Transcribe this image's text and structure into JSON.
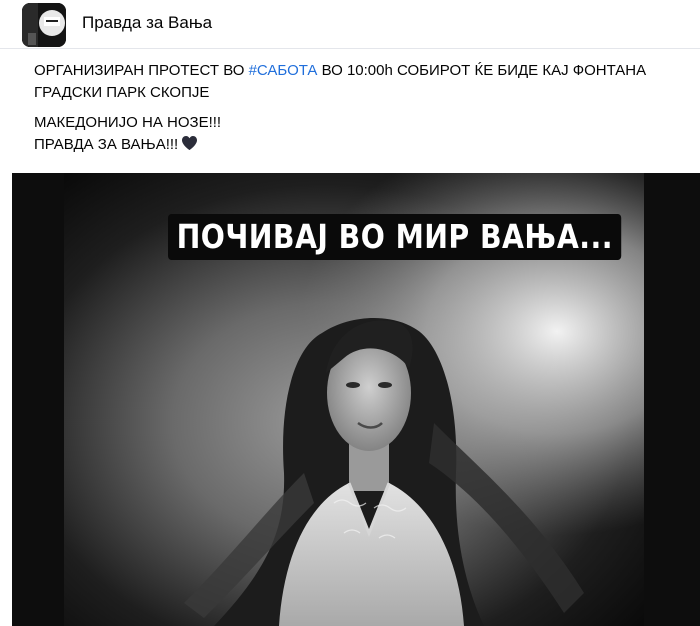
{
  "header": {
    "page_name": "Правда за Вања",
    "avatar_icon": "page-avatar-photo"
  },
  "post": {
    "line1_before": "ОРГАНИЗИРАН ПРОТЕСТ ВО ",
    "hashtag": "#САБОТА",
    "line1_after": " ВО 10:00h СОБИРОТ ЌЕ БИДЕ  КАЈ ФОНТАНА ГРАДСКИ ПАРК СКОПЈЕ",
    "line2": "МАКЕДОНИЈО НА НОЗЕ!!!",
    "line3": "ПРАВДА ЗА ВАЊА!!!",
    "heart_icon": "black-heart-emoji"
  },
  "photo": {
    "overlay_text": "ПОЧИВАЈ ВО МИР ВАЊА...",
    "colors": {
      "frame": "#0d0d0d",
      "banner": "#0a0a0a",
      "hashtag": "#216fdb"
    }
  }
}
